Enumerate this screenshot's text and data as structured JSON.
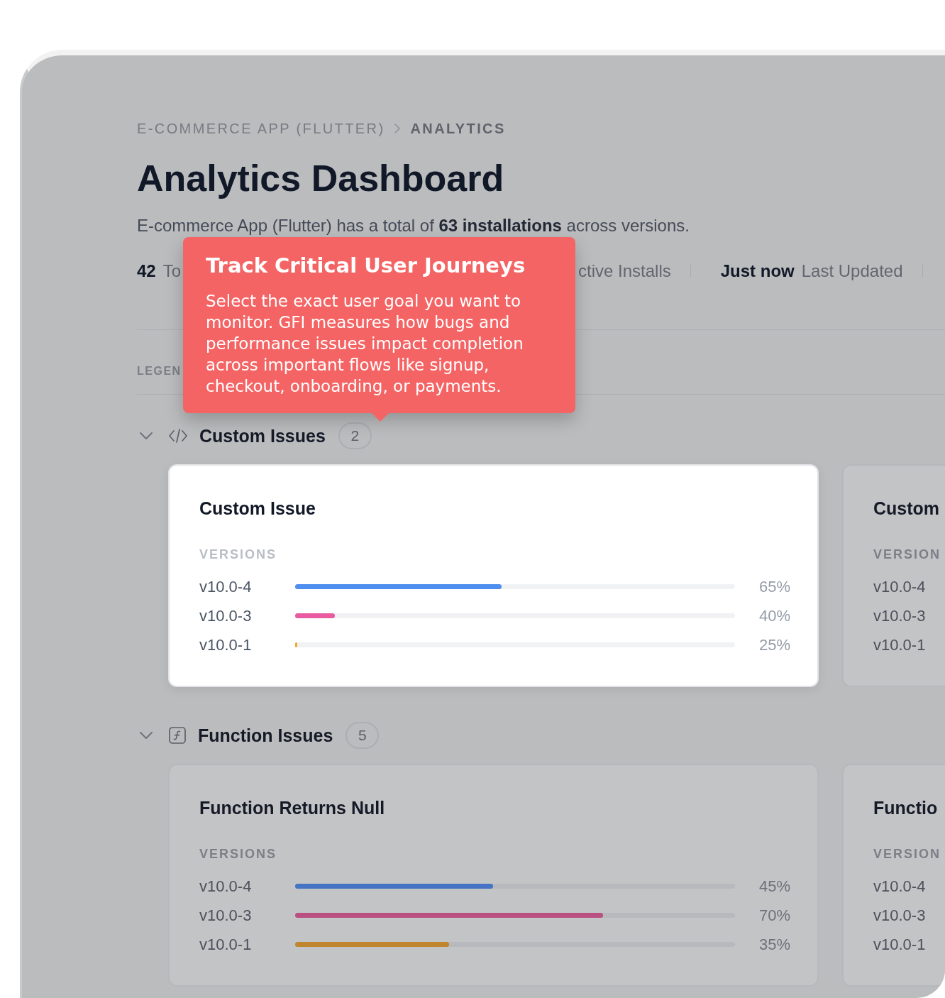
{
  "breadcrumb": [
    {
      "label": "E-COMMERCE APP (FLUTTER)",
      "current": false
    },
    {
      "label": "ANALYTICS",
      "current": true
    }
  ],
  "page": {
    "title": "Analytics Dashboard",
    "description": "E-commerce App (Flutter) has a total of **63 installations** across versions."
  },
  "stats": [
    {
      "value": "42",
      "label": "To"
    },
    {
      "label": "ctive Installs"
    },
    {
      "value": "Just now",
      "label": "Last Updated"
    }
  ],
  "legend": {
    "title": "LEGEN"
  },
  "tooltip": {
    "title": "Track Critical User Journeys",
    "body": "Select the exact user goal you want to monitor. GFI measures how bugs and performance issues impact completion across important flows like signup, checkout, onboarding, or payments."
  },
  "sections": [
    {
      "kind": "custom",
      "title": "Custom Issues",
      "count": "2",
      "expanded": true,
      "cards": [
        {
          "title": "Custom Issue",
          "highlighted": true,
          "versions_label": "VERSIONS",
          "versions": [
            {
              "name": "v10.0-4",
              "level": 0.47,
              "value": "65%",
              "color": "#4f8ff0"
            },
            {
              "name": "v10.0-3",
              "level": 0.09,
              "value": "40%",
              "color": "#e95ba0"
            },
            {
              "name": "v10.0-1",
              "level": 0.005,
              "value": "25%",
              "color": "#f2a72f"
            }
          ]
        },
        {
          "title": "Custom",
          "highlighted": false,
          "versions_label": "VERSION",
          "versions": [
            {
              "name": "v10.0-4"
            },
            {
              "name": "v10.0-3"
            },
            {
              "name": "v10.0-1"
            }
          ]
        }
      ]
    },
    {
      "kind": "function",
      "title": "Function Issues",
      "count": "5",
      "expanded": true,
      "cards": [
        {
          "title": "Function Returns Null",
          "highlighted": false,
          "versions_label": "VERSIONS",
          "versions": [
            {
              "name": "v10.0-4",
              "level": 0.45,
              "value": "45%",
              "color": "#4673c4"
            },
            {
              "name": "v10.0-3",
              "level": 0.7,
              "value": "70%",
              "color": "#ba4f81"
            },
            {
              "name": "v10.0-1",
              "level": 0.35,
              "value": "35%",
              "color": "#c0852f"
            }
          ]
        },
        {
          "title": "Functio",
          "highlighted": false,
          "versions_label": "VERSION",
          "versions": [
            {
              "name": "v10.0-4"
            },
            {
              "name": "v10.0-3"
            },
            {
              "name": "v10.0-1"
            }
          ]
        }
      ]
    }
  ]
}
